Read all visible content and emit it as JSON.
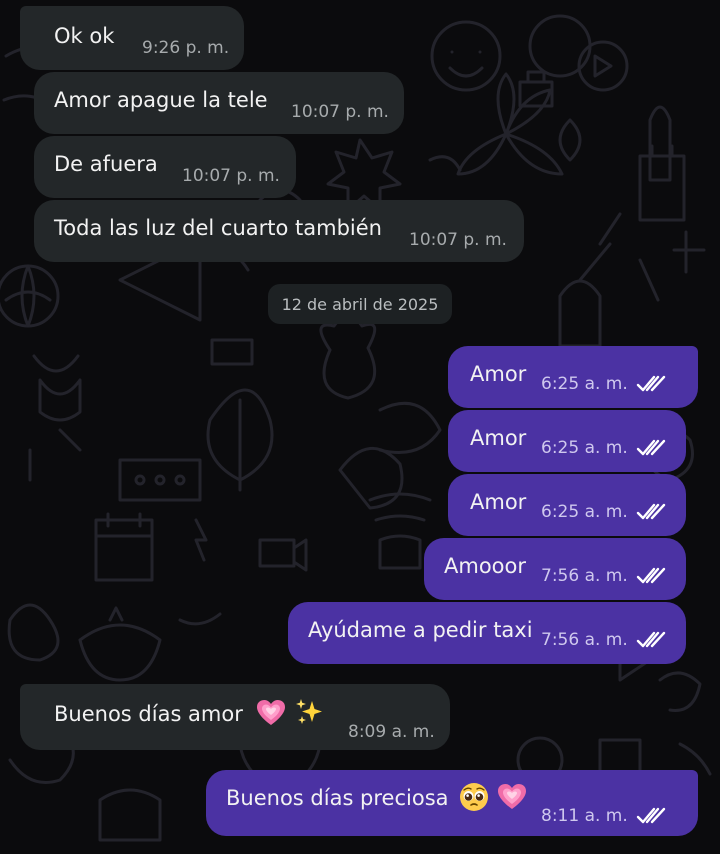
{
  "messages": [
    {
      "text": "Ok ok",
      "time": "9:26 p. m."
    },
    {
      "text": "Amor apague la tele",
      "time": "10:07 p. m."
    },
    {
      "text": "De afuera",
      "time": "10:07 p. m."
    },
    {
      "text": "Toda las luz del cuarto también",
      "time": "10:07 p. m."
    },
    {
      "text": "Amor",
      "time": "6:25 a. m."
    },
    {
      "text": "Amor",
      "time": "6:25 a. m."
    },
    {
      "text": "Amor",
      "time": "6:25 a. m."
    },
    {
      "text": "Amooor",
      "time": "7:56 a. m."
    },
    {
      "text": "Ayúdame a pedir taxi",
      "time": "7:56 a. m."
    },
    {
      "text": "Buenos días amor",
      "time": "8:09 a. m.",
      "emojis": [
        "growing-heart",
        "sparkles"
      ]
    },
    {
      "text": "Buenos días preciosa",
      "time": "8:11 a. m.",
      "emojis": [
        "pleading-face",
        "growing-heart"
      ]
    }
  ],
  "date_separator": "12 de abril de 2025",
  "colors": {
    "background": "#0b0b0d",
    "incoming": "#232729",
    "outgoing": "#4b32a3",
    "read_ticks": "#ffffff"
  },
  "icons": {
    "read_receipt": "double-check-icon"
  }
}
